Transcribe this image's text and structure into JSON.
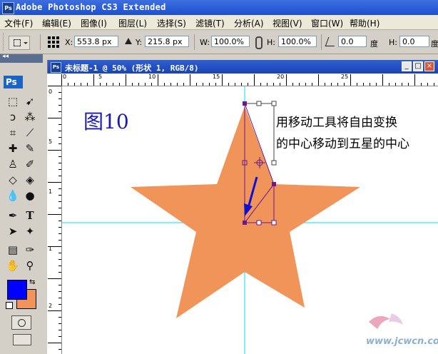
{
  "app": {
    "icon": "Ps",
    "title": "Adobe Photoshop CS3 Extended"
  },
  "menu": [
    "文件(F)",
    "编辑(E)",
    "图像(I)",
    "图层(L)",
    "选择(S)",
    "滤镜(T)",
    "分析(A)",
    "视图(V)",
    "窗口(W)",
    "帮助(H)"
  ],
  "options": {
    "x_label": "X:",
    "x_value": "553.8 px",
    "y_label": "Y:",
    "y_value": "215.8 px",
    "w_label": "W:",
    "w_value": "100.0%",
    "h_label": "H:",
    "h_value": "100.0%",
    "angle_value": "0.0",
    "angle_unit": "度",
    "hskew_label": "H:",
    "hskew_value": "0.0",
    "hskew_unit": "度"
  },
  "toolbox": {
    "logo": "Ps",
    "foreground_color": "#0000ff",
    "background_color": "#f0945a"
  },
  "document": {
    "icon": "Ps",
    "title": "未标题-1 @ 50% (形状 1, RGB/8)",
    "min_label": "_",
    "max_label": "□",
    "close_label": "×"
  },
  "rulers": {
    "h_labels": [
      "0",
      "5",
      "10",
      "15",
      "20",
      "25"
    ],
    "v_labels": [
      "0",
      "5",
      "1",
      "1",
      "2"
    ]
  },
  "canvas": {
    "figure_label": "图10",
    "note_lines": [
      "用移动工具将自由变换",
      "的中心移动到五星的中心"
    ],
    "star_color": "#f0945a",
    "guide_color": "#00e0ff",
    "arrow_color": "#1010d0",
    "watermark": "www.jcwcn.com"
  }
}
